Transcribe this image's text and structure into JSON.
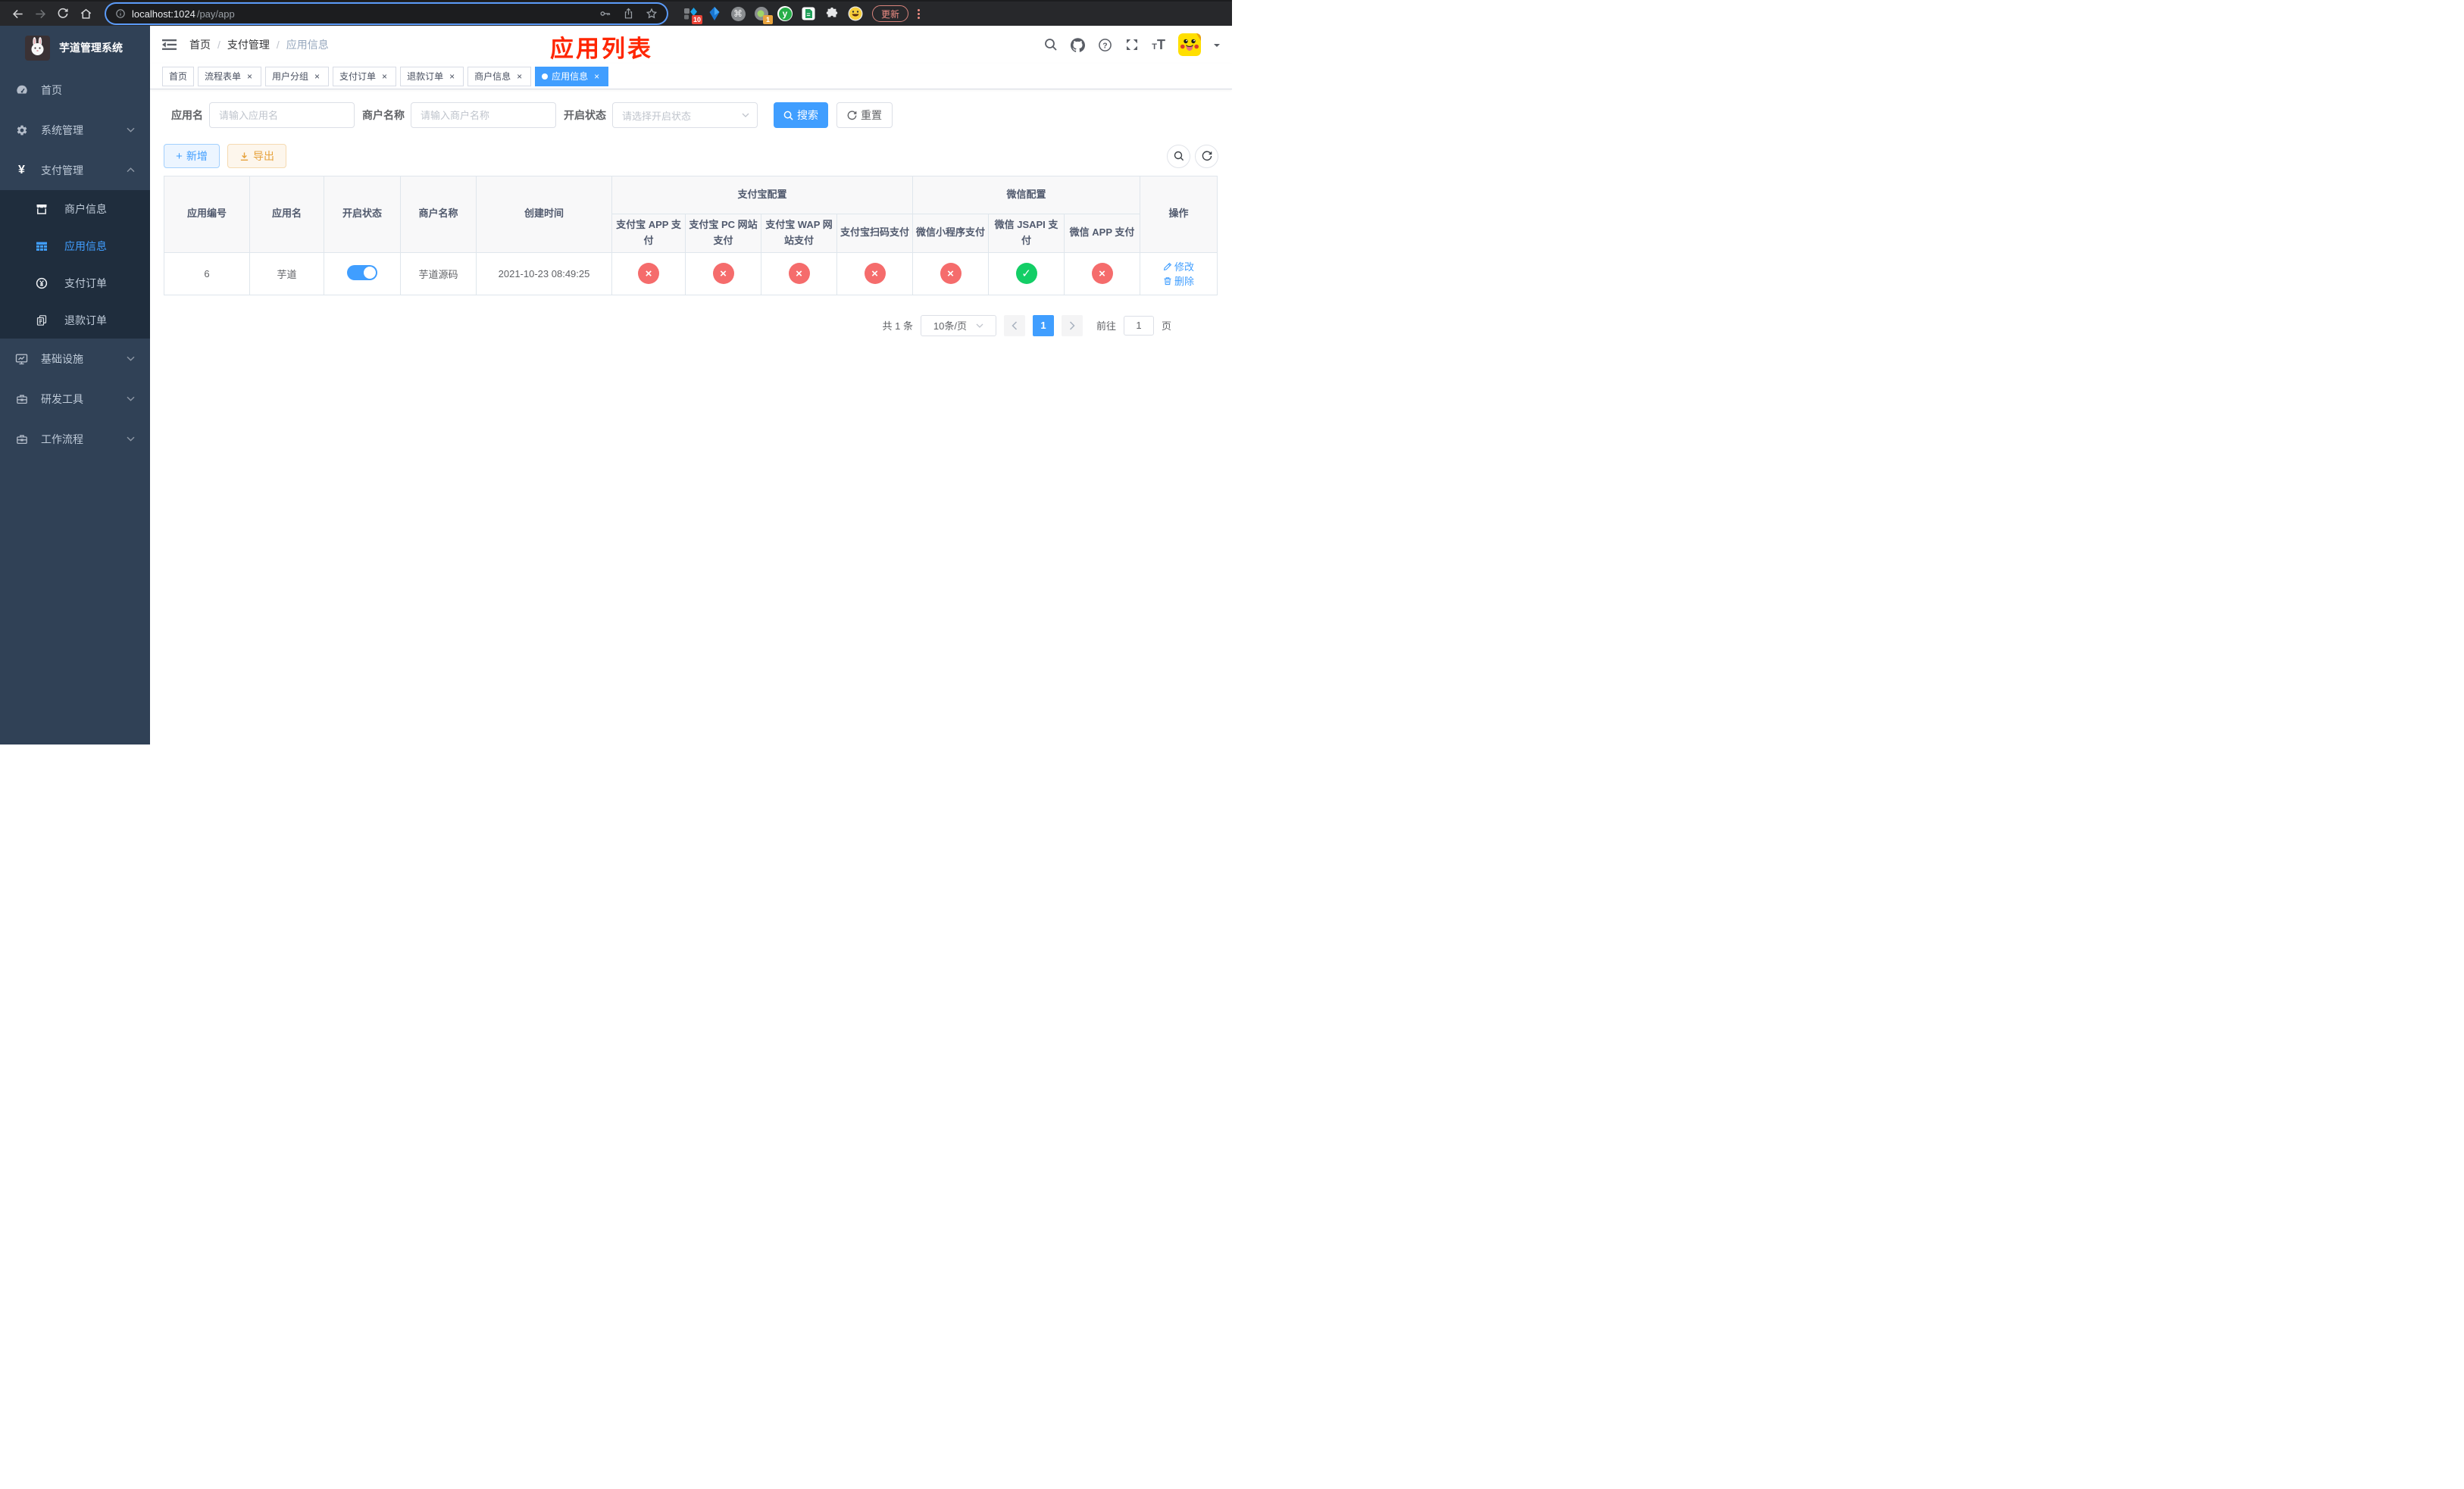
{
  "browser": {
    "url_host": "localhost:1024",
    "url_path": "/pay/app",
    "update_label": "更新",
    "ext_badge_monkey": "10",
    "ext_badge_proxy": "1"
  },
  "colors": {
    "accent": "#409eff",
    "disabled_red": "#f56c6c",
    "enabled_green": "#13ce66",
    "annotation_red": "#ff2600",
    "sidebar_bg": "#304156",
    "submenu_bg": "#1f2d3d"
  },
  "icons": {
    "close": "×",
    "cross": "×",
    "check": "✓",
    "plus": "+",
    "yen": "¥",
    "font": "T",
    "help": "?",
    "command": "⌘",
    "y_letter": "y"
  },
  "sidebar": {
    "title": "芋道管理系统",
    "items": [
      {
        "label": "首页",
        "icon": "dashboard-icon",
        "state": "none"
      },
      {
        "label": "系统管理",
        "icon": "gear-icon",
        "state": "collapsed"
      },
      {
        "label": "支付管理",
        "icon": "yen-icon",
        "state": "expanded"
      },
      {
        "label": "基础设施",
        "icon": "monitor-icon",
        "state": "collapsed"
      },
      {
        "label": "研发工具",
        "icon": "toolbox-icon",
        "state": "collapsed"
      },
      {
        "label": "工作流程",
        "icon": "briefcase-icon",
        "state": "collapsed"
      }
    ],
    "submenu": [
      {
        "label": "商户信息",
        "icon": "store-icon",
        "active": false
      },
      {
        "label": "应用信息",
        "icon": "grid-icon",
        "active": true
      },
      {
        "label": "支付订单",
        "icon": "coin-icon",
        "active": false
      },
      {
        "label": "退款订单",
        "icon": "copy-icon",
        "active": false
      }
    ]
  },
  "header": {
    "breadcrumb": [
      "首页",
      "支付管理",
      "应用信息"
    ],
    "separator": "/",
    "overlay_title": "应用列表"
  },
  "tabs": [
    {
      "label": "首页",
      "closable": false,
      "active": false
    },
    {
      "label": "流程表单",
      "closable": true,
      "active": false
    },
    {
      "label": "用户分组",
      "closable": true,
      "active": false
    },
    {
      "label": "支付订单",
      "closable": true,
      "active": false
    },
    {
      "label": "退款订单",
      "closable": true,
      "active": false
    },
    {
      "label": "商户信息",
      "closable": true,
      "active": false
    },
    {
      "label": "应用信息",
      "closable": true,
      "active": true
    }
  ],
  "filters": {
    "app_name_label": "应用名",
    "app_name_placeholder": "请输入应用名",
    "merchant_label": "商户名称",
    "merchant_placeholder": "请输入商户名称",
    "status_label": "开启状态",
    "status_placeholder": "请选择开启状态",
    "search_label": "搜索",
    "reset_label": "重置"
  },
  "toolbar": {
    "add_label": "新增",
    "export_label": "导出"
  },
  "table": {
    "columns": {
      "app_id": "应用编号",
      "app_name": "应用名",
      "status": "开启状态",
      "merchant_name": "商户名称",
      "created_at": "创建时间",
      "actions": "操作"
    },
    "groups": {
      "alipay": "支付宝配置",
      "wechat": "微信配置"
    },
    "sub_columns": [
      "支付宝 APP 支付",
      "支付宝 PC 网站支付",
      "支付宝 WAP 网站支付",
      "支付宝扫码支付",
      "微信小程序支付",
      "微信 JSAPI 支付",
      "微信 APP 支付"
    ],
    "row": {
      "app_id": "6",
      "app_name": "芋道",
      "status_on": true,
      "merchant_name": "芋道源码",
      "created_at": "2021-10-23 08:49:25",
      "channels": [
        {
          "name": "alipay-app-pay",
          "enabled": false
        },
        {
          "name": "alipay-pc-pay",
          "enabled": false
        },
        {
          "name": "alipay-wap-pay",
          "enabled": false
        },
        {
          "name": "alipay-qr-pay",
          "enabled": false
        },
        {
          "name": "wechat-lite-pay",
          "enabled": false
        },
        {
          "name": "wechat-jsapi-pay",
          "enabled": true
        },
        {
          "name": "wechat-app-pay",
          "enabled": false
        }
      ],
      "edit_label": "修改",
      "delete_label": "删除"
    }
  },
  "pagination": {
    "total": "共 1 条",
    "page_size": "10条/页",
    "current_page": "1",
    "goto_label": "前往",
    "goto_value": "1",
    "page_unit": "页"
  }
}
